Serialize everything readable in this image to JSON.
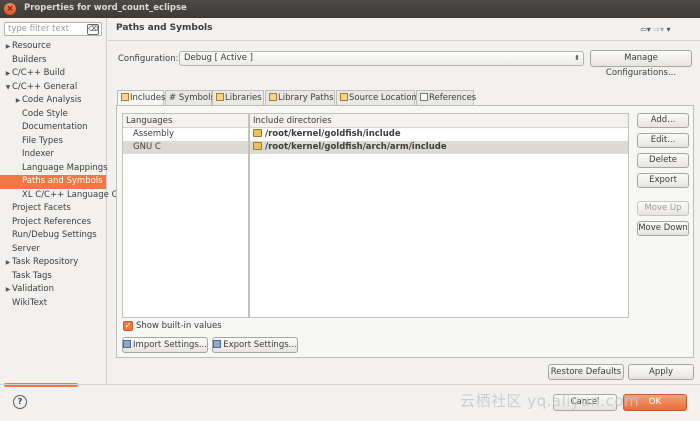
{
  "window": {
    "title": "Properties for word_count_eclipse"
  },
  "left": {
    "filter_placeholder": "type filter text",
    "tree": [
      {
        "label": "Resource",
        "expand": true,
        "indent": 0,
        "selected": false
      },
      {
        "label": "Builders",
        "expand": false,
        "indent": 0,
        "selected": false
      },
      {
        "label": "C/C++ Build",
        "expand": true,
        "indent": 0,
        "selected": false
      },
      {
        "label": "C/C++ General",
        "expand": true,
        "open": true,
        "indent": 0,
        "selected": false
      },
      {
        "label": "Code Analysis",
        "expand": true,
        "indent": 1,
        "selected": false
      },
      {
        "label": "Code Style",
        "expand": false,
        "indent": 1,
        "selected": false
      },
      {
        "label": "Documentation",
        "expand": false,
        "indent": 1,
        "selected": false
      },
      {
        "label": "File Types",
        "expand": false,
        "indent": 1,
        "selected": false
      },
      {
        "label": "Indexer",
        "expand": false,
        "indent": 1,
        "selected": false
      },
      {
        "label": "Language Mappings",
        "expand": false,
        "indent": 1,
        "selected": false
      },
      {
        "label": "Paths and Symbols",
        "expand": false,
        "indent": 1,
        "selected": true
      },
      {
        "label": "XL C/C++ Language C",
        "expand": false,
        "indent": 1,
        "selected": false
      },
      {
        "label": "Project Facets",
        "expand": false,
        "indent": 0,
        "selected": false
      },
      {
        "label": "Project References",
        "expand": false,
        "indent": 0,
        "selected": false
      },
      {
        "label": "Run/Debug Settings",
        "expand": false,
        "indent": 0,
        "selected": false
      },
      {
        "label": "Server",
        "expand": false,
        "indent": 0,
        "selected": false
      },
      {
        "label": "Task Repository",
        "expand": true,
        "indent": 0,
        "selected": false
      },
      {
        "label": "Task Tags",
        "expand": false,
        "indent": 0,
        "selected": false
      },
      {
        "label": "Validation",
        "expand": true,
        "indent": 0,
        "selected": false
      },
      {
        "label": "WikiText",
        "expand": false,
        "indent": 0,
        "selected": false
      }
    ]
  },
  "page": {
    "heading": "Paths and Symbols",
    "configuration_label": "Configuration:",
    "configuration_value": "Debug [ Active ]",
    "manage_button": "Manage Configurations...",
    "tabs": [
      {
        "label": "Includes",
        "active": true
      },
      {
        "label": "# Symbols",
        "active": false
      },
      {
        "label": "Libraries",
        "active": false
      },
      {
        "label": "Library Paths",
        "active": false
      },
      {
        "label": "Source Location",
        "active": false
      },
      {
        "label": "References",
        "active": false
      }
    ],
    "languages_header": "Languages",
    "languages": [
      {
        "label": "Assembly",
        "selected": false
      },
      {
        "label": "GNU C",
        "selected": true
      }
    ],
    "includes_header": "Include directories",
    "includes": [
      {
        "label": "/root/kernel/goldfish/include",
        "selected": false
      },
      {
        "label": "/root/kernel/goldfish/arch/arm/include",
        "selected": true
      }
    ],
    "side_buttons": [
      {
        "label": "Add...",
        "enabled": true
      },
      {
        "label": "Edit...",
        "enabled": true
      },
      {
        "label": "Delete",
        "enabled": true
      },
      {
        "label": "Export",
        "enabled": true
      },
      {
        "label": "Move Up",
        "enabled": false
      },
      {
        "label": "Move Down",
        "enabled": true
      }
    ],
    "show_builtin_label": "Show built-in values",
    "show_builtin_checked": true,
    "import_button": "Import Settings...",
    "export_button": "Export Settings...",
    "restore_button": "Restore Defaults",
    "apply_button": "Apply"
  },
  "footer": {
    "help_icon": "?",
    "cancel_button": "Cancel",
    "ok_button": "OK",
    "watermark": "云栖社区 yq.aliyun.com"
  },
  "colors": {
    "accent": "#f07746",
    "selection_gray": "#dcdad5",
    "titlebar": "#3c3b37"
  }
}
